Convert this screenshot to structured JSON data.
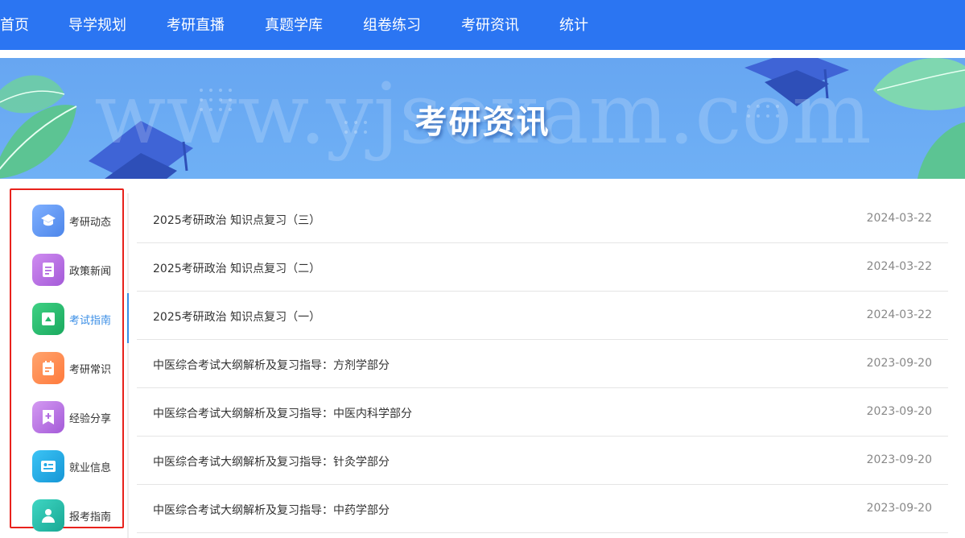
{
  "nav": {
    "items": [
      "首页",
      "导学规划",
      "考研直播",
      "真题学库",
      "组卷练习",
      "考研资讯",
      "统计"
    ]
  },
  "banner": {
    "title": "考研资讯",
    "watermark": "www.yjsexam.com"
  },
  "sidebar": {
    "items": [
      {
        "label": "考研动态",
        "icon": "graduation-cap-icon",
        "color": "#5b8ff0",
        "active": false
      },
      {
        "label": "政策新闻",
        "icon": "document-icon",
        "color": "#b06ae0",
        "active": false
      },
      {
        "label": "考试指南",
        "icon": "guide-triangle-icon",
        "color": "#22b86b",
        "active": true
      },
      {
        "label": "考研常识",
        "icon": "notepad-icon",
        "color": "#ff8a4d",
        "active": false
      },
      {
        "label": "经验分享",
        "icon": "bookmark-plus-icon",
        "color": "#b06ae0",
        "active": false
      },
      {
        "label": "就业信息",
        "icon": "id-card-icon",
        "color": "#1ea8e6",
        "active": false
      },
      {
        "label": "报考指南",
        "icon": "user-icon",
        "color": "#22b8a8",
        "active": false
      }
    ],
    "active_color": "#3a8ee6",
    "highlight_border_color": "#e8221c"
  },
  "articles": [
    {
      "title": "2025考研政治 知识点复习（三）",
      "date": "2024-03-22"
    },
    {
      "title": "2025考研政治 知识点复习（二）",
      "date": "2024-03-22"
    },
    {
      "title": "2025考研政治 知识点复习（一）",
      "date": "2024-03-22"
    },
    {
      "title": "中医综合考试大纲解析及复习指导：方剂学部分",
      "date": "2023-09-20"
    },
    {
      "title": "中医综合考试大纲解析及复习指导：中医内科学部分",
      "date": "2023-09-20"
    },
    {
      "title": "中医综合考试大纲解析及复习指导：针灸学部分",
      "date": "2023-09-20"
    },
    {
      "title": "中医综合考试大纲解析及复习指导：中药学部分",
      "date": "2023-09-20"
    }
  ],
  "colors": {
    "nav_bg": "#2b75f2",
    "banner_bg": "#6fb0f5"
  }
}
